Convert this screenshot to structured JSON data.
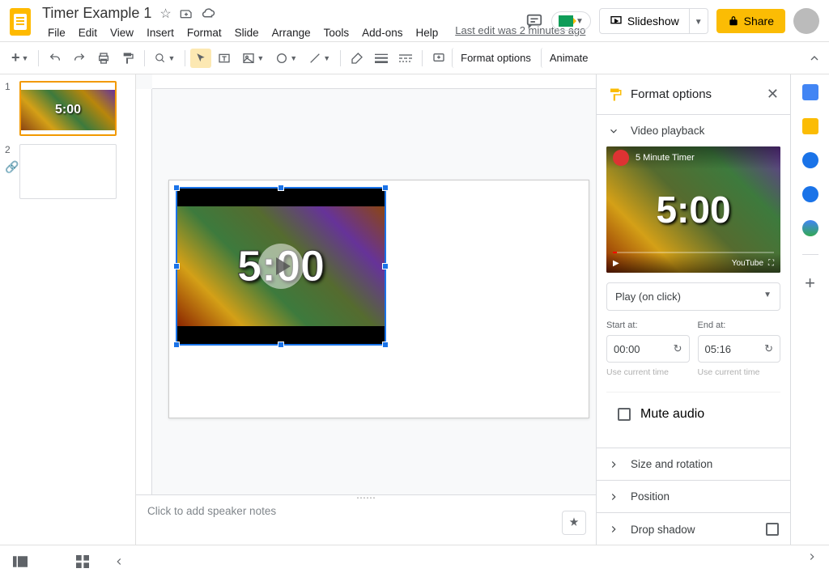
{
  "header": {
    "title": "Timer Example 1",
    "last_edit": "Last edit was 2 minutes ago",
    "slideshow": "Slideshow",
    "share": "Share"
  },
  "menu": [
    "File",
    "Edit",
    "View",
    "Insert",
    "Format",
    "Slide",
    "Arrange",
    "Tools",
    "Add-ons",
    "Help"
  ],
  "toolbar": {
    "format_options": "Format options",
    "animate": "Animate"
  },
  "slides": [
    {
      "num": "1",
      "text": "5:00"
    },
    {
      "num": "2",
      "text": ""
    }
  ],
  "canvas": {
    "video_text": "5:00"
  },
  "notes": {
    "placeholder": "Click to add speaker notes"
  },
  "format_panel": {
    "title": "Format options",
    "video_playback": "Video playback",
    "preview_title": "5 Minute Timer",
    "preview_time": "5:00",
    "youtube": "YouTube",
    "play_mode": "Play (on click)",
    "start_label": "Start at:",
    "end_label": "End at:",
    "start_value": "00:00",
    "end_value": "05:16",
    "use_current": "Use current time",
    "mute": "Mute audio",
    "size_rotation": "Size and rotation",
    "position": "Position",
    "drop_shadow": "Drop shadow"
  }
}
